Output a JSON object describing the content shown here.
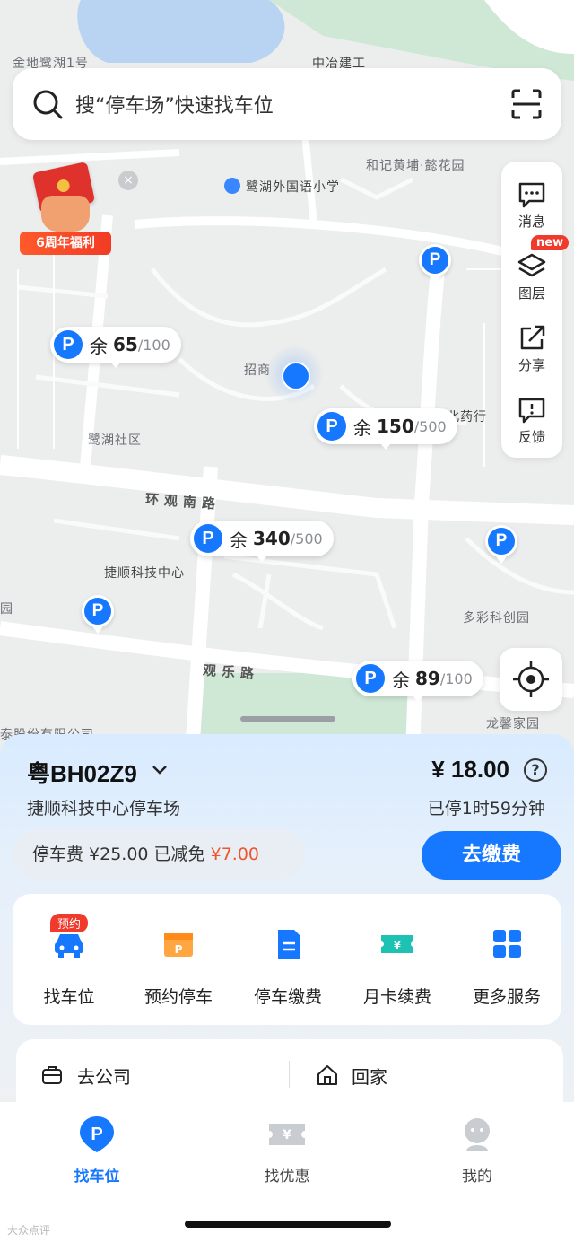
{
  "search": {
    "placeholder": "搜“停车场”快速找车位"
  },
  "promo": {
    "label": "6周年福利"
  },
  "map": {
    "labels": {
      "l1": "金地鹭湖1号",
      "l2": "中冶建工",
      "l3": "和记黄埔·懿花园",
      "l4": "鹭湖外国语小学",
      "l5": "招商",
      "l6": "北药行",
      "l7": "鹭湖社区",
      "l8": "捷顺科技中心",
      "l9": "多彩科创园",
      "l10": "龙馨家园",
      "l11": "园",
      "l12": "泰股份有限公司"
    },
    "roads": {
      "r1": "环观南路",
      "r2": "观乐路"
    }
  },
  "tools": {
    "msg": "消息",
    "layer": "图层",
    "share": "分享",
    "feedback": "反馈",
    "new_badge": "new"
  },
  "markers": [
    {
      "p": "P",
      "remain_label": "余",
      "num": "65",
      "total": "/100"
    },
    {
      "p": "P",
      "remain_label": "余",
      "num": "150",
      "total": "/500"
    },
    {
      "p": "P",
      "remain_label": "余",
      "num": "340",
      "total": "/500"
    },
    {
      "p": "P",
      "remain_label": "余",
      "num": "89",
      "total": "/100"
    }
  ],
  "pin_label": "P",
  "order": {
    "plate": "粤BH02Z9",
    "fee": "¥ 18.00",
    "help": "?",
    "lot": "捷顺科技中心停车场",
    "duration": "已停1时59分钟",
    "discount_prefix": "停车费 ¥25.00 已减免 ",
    "discount_value": "¥7.00",
    "pay_label": "去缴费"
  },
  "services": [
    {
      "label": "找车位",
      "badge": "预约"
    },
    {
      "label": "预约停车"
    },
    {
      "label": "停车缴费"
    },
    {
      "label": "月卡续费"
    },
    {
      "label": "更多服务"
    }
  ],
  "quick": {
    "company": "去公司",
    "home": "回家"
  },
  "tabs": [
    {
      "label": "找车位",
      "active": true
    },
    {
      "label": "找优惠"
    },
    {
      "label": "我的"
    }
  ],
  "watermark": "大众点评",
  "colors": {
    "accent": "#1677ff",
    "danger": "#f03a2b",
    "discount": "#f2532b"
  }
}
